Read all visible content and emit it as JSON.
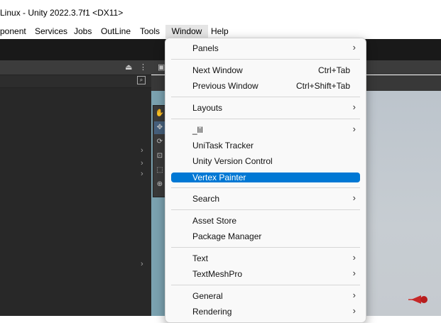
{
  "window": {
    "title": "Linux - Unity 2022.3.7f1 <DX11>"
  },
  "menubar": {
    "items": [
      "ponent",
      "Services",
      "Jobs",
      "OutLine",
      "Tools",
      "Window",
      "Help"
    ],
    "active": "Window"
  },
  "panel": {
    "lock_icon": "lock-icon",
    "more_icon": "more-vertical-icon"
  },
  "scene": {
    "tools": [
      "hand-tool-icon",
      "move-tool-icon",
      "rotate-tool-icon",
      "scale-tool-icon",
      "rect-tool-icon",
      "transform-tool-icon"
    ]
  },
  "window_menu": {
    "items": [
      {
        "label": "Panels",
        "submenu": true
      },
      {
        "label": "Next Window",
        "shortcut": "Ctrl+Tab"
      },
      {
        "label": "Previous Window",
        "shortcut": "Ctrl+Shift+Tab"
      },
      {
        "label": "Layouts",
        "submenu": true
      },
      {
        "label": "_lil",
        "submenu": true
      },
      {
        "label": "UniTask Tracker"
      },
      {
        "label": "Unity Version Control"
      },
      {
        "label": "Vertex Painter",
        "highlighted": true
      },
      {
        "label": "Search",
        "submenu": true
      },
      {
        "label": "Asset Store"
      },
      {
        "label": "Package Manager"
      },
      {
        "label": "Text",
        "submenu": true
      },
      {
        "label": "TextMeshPro",
        "submenu": true
      },
      {
        "label": "General",
        "submenu": true
      },
      {
        "label": "Rendering",
        "submenu": true
      }
    ],
    "submenu_glyph": "›"
  },
  "colors": {
    "highlight": "#0078d4",
    "menu_bg": "#f9f9f9",
    "editor_dark": "#282828"
  }
}
